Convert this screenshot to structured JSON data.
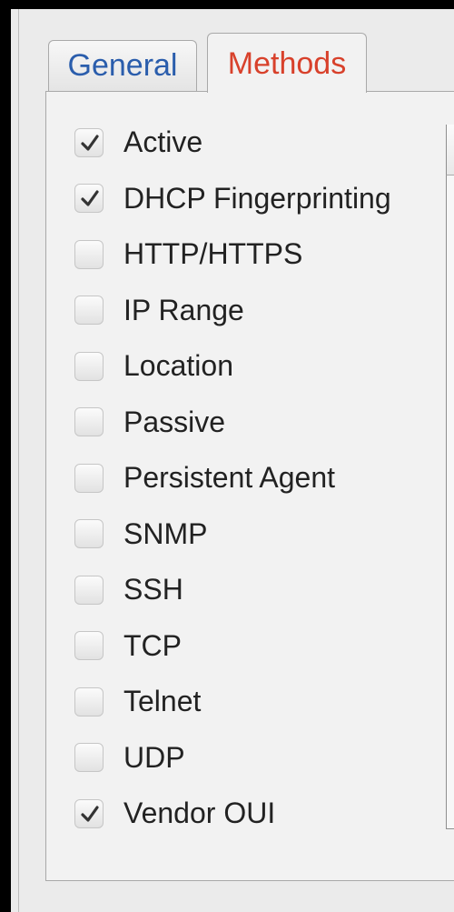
{
  "tabs": [
    {
      "label": "General",
      "active": false
    },
    {
      "label": "Methods",
      "active": true
    }
  ],
  "methods": [
    {
      "label": "Active",
      "checked": true
    },
    {
      "label": "DHCP Fingerprinting",
      "checked": true
    },
    {
      "label": "HTTP/HTTPS",
      "checked": false
    },
    {
      "label": "IP Range",
      "checked": false
    },
    {
      "label": "Location",
      "checked": false
    },
    {
      "label": "Passive",
      "checked": false
    },
    {
      "label": "Persistent Agent",
      "checked": false
    },
    {
      "label": "SNMP",
      "checked": false
    },
    {
      "label": "SSH",
      "checked": false
    },
    {
      "label": "TCP",
      "checked": false
    },
    {
      "label": "Telnet",
      "checked": false
    },
    {
      "label": "UDP",
      "checked": false
    },
    {
      "label": "Vendor OUI",
      "checked": true
    }
  ],
  "colors": {
    "active_tab_text": "#d8412b",
    "inactive_tab_text": "#2a5dac"
  },
  "icons": {
    "checkmark": "checkmark-icon"
  }
}
